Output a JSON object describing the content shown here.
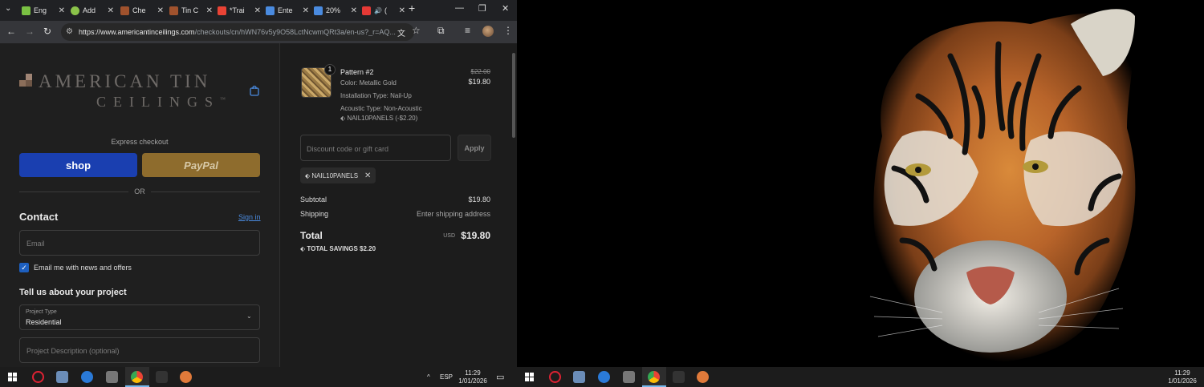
{
  "browser": {
    "tabs": [
      {
        "label": "Eng",
        "color": "#7ac143"
      },
      {
        "label": "Add",
        "color": "#8bc34a"
      },
      {
        "label": "Che",
        "color": "#a0522d"
      },
      {
        "label": "Tin C",
        "color": "#a0522d"
      },
      {
        "label": "*Trai",
        "color": "#ea4335"
      },
      {
        "label": "Ente",
        "color": "#4a8be0"
      },
      {
        "label": "20%",
        "color": "#4a8be0"
      },
      {
        "label": "(",
        "color": "#e53935"
      }
    ],
    "url_domain": "https://www.americantinceilings.com",
    "url_path": "/checkouts/cn/hWN76v5y9O58LctNcwmQRt3a/en-us?_r=AQ..."
  },
  "store": {
    "logo_line1": "AMERICAN TIN",
    "logo_line2": "CEILINGS",
    "logo_tm": "™"
  },
  "checkout": {
    "express_label": "Express checkout",
    "shop_label": "shop",
    "paypal_label": "PayPal",
    "or_label": "OR",
    "contact_heading": "Contact",
    "signin_label": "Sign in",
    "email_placeholder": "Email",
    "news_label": "Email me with news and offers",
    "project_heading": "Tell us about your project",
    "project_type_label": "Project Type",
    "project_type_value": "Residential",
    "project_desc_placeholder": "Project Description (optional)"
  },
  "summary": {
    "qty": "1",
    "product_name": "Pattern #2",
    "color": "Color: Metallic Gold",
    "installation": "Installation Type: Nail-Up",
    "acoustic": "Acoustic Type: Non-Acoustic",
    "line_discount": "NAIL10PANELS (-$2.20)",
    "price_old": "$22.00",
    "price_new": "$19.80",
    "discount_placeholder": "Discount code or gift card",
    "apply_label": "Apply",
    "applied_code": "NAIL10PANELS",
    "subtotal_label": "Subtotal",
    "subtotal_value": "$19.80",
    "shipping_label": "Shipping",
    "shipping_value": "Enter shipping address",
    "total_label": "Total",
    "total_currency": "USD",
    "total_value": "$19.80",
    "savings": "TOTAL SAVINGS  $2.20"
  },
  "taskbar": {
    "lang": "ESP",
    "time": "11:29",
    "date": "1/01/2026"
  },
  "colors": {
    "accent": "#1d5fbf",
    "shop_blue": "#1a3fb0",
    "paypal_gold": "#8e6c2d",
    "link": "#4a8be0"
  }
}
